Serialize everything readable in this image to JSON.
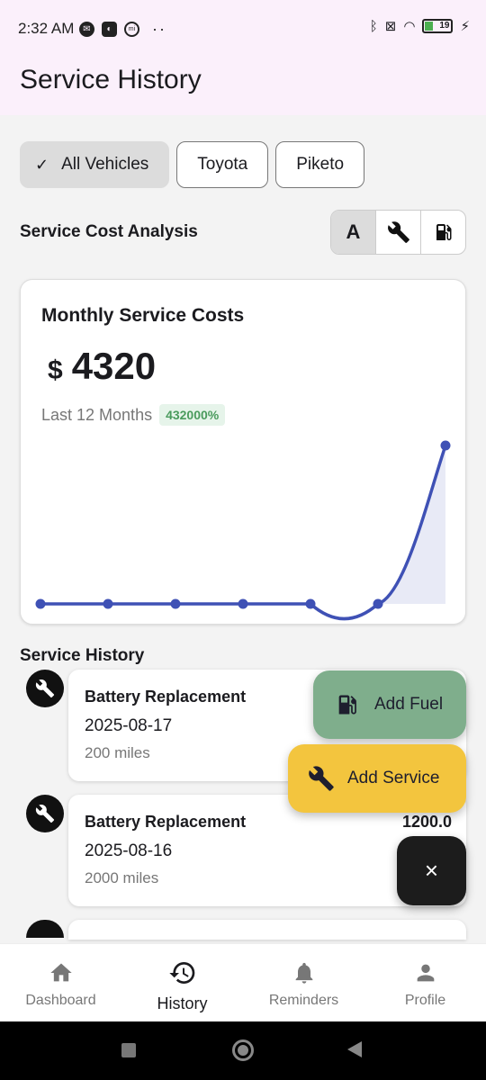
{
  "status": {
    "time": "2:32 AM",
    "battery": "19"
  },
  "appbar": {
    "title": "Service History"
  },
  "filters": {
    "chips": [
      "All Vehicles",
      "Toyota",
      "Piketo"
    ]
  },
  "analysis": {
    "label": "Service Cost Analysis",
    "segments": [
      "A",
      "wrench",
      "fuel"
    ]
  },
  "summary_card": {
    "title": "Monthly Service Costs",
    "currency": "$",
    "amount": "4320",
    "period": "Last 12 Months",
    "change": "432000%"
  },
  "chart_data": {
    "type": "line",
    "x": [
      1,
      2,
      3,
      4,
      5,
      6,
      7
    ],
    "values": [
      0,
      0,
      0,
      0,
      0,
      0,
      4320
    ],
    "title": "",
    "xlabel": "",
    "ylabel": "",
    "grid": false
  },
  "history": {
    "title": "Service History",
    "items": [
      {
        "title": "Battery Replacement",
        "date": "2025-08-17",
        "miles": "200 miles",
        "cost": ""
      },
      {
        "title": "Battery Replacement",
        "date": "2025-08-16",
        "miles": "2000 miles",
        "cost": "1200.0"
      }
    ]
  },
  "fabs": {
    "fuel": "Add Fuel",
    "service": "Add Service",
    "close": "×"
  },
  "nav": {
    "items": [
      "Dashboard",
      "History",
      "Reminders",
      "Profile"
    ]
  },
  "colors": {
    "accent": "#3f51b5",
    "fuel": "#7fae8c",
    "service": "#f3c53e"
  }
}
